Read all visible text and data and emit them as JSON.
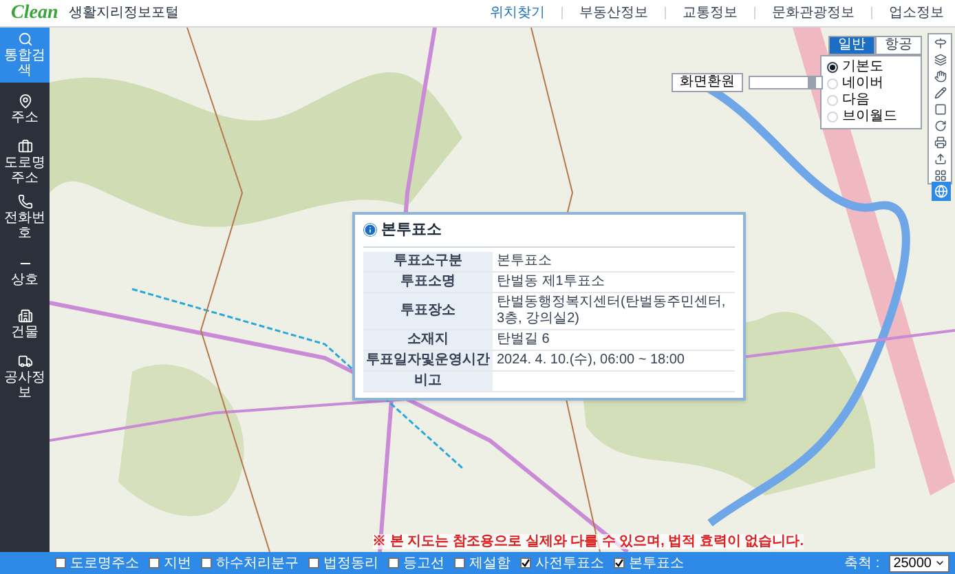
{
  "header": {
    "logo_text": "Clean",
    "title": "생활지리정보포털",
    "nav": [
      {
        "label": "위치찾기",
        "selected": true
      },
      {
        "label": "부동산정보",
        "selected": false
      },
      {
        "label": "교통정보",
        "selected": false
      },
      {
        "label": "문화관광정보",
        "selected": false
      },
      {
        "label": "업소정보",
        "selected": false
      }
    ]
  },
  "sidebar": {
    "items": [
      {
        "label": "통합검색",
        "selected": true
      },
      {
        "label": "주소",
        "selected": false
      },
      {
        "label": "도로명주소",
        "selected": false
      },
      {
        "label": "전화번호",
        "selected": false
      },
      {
        "label": "상호",
        "selected": false
      },
      {
        "label": "건물",
        "selected": false
      },
      {
        "label": "공사정보",
        "selected": false
      }
    ]
  },
  "map_controls": {
    "reset_button": "화면환원",
    "zoom_slider": {
      "level": 0.93
    },
    "map_type_tabs": [
      {
        "label": "일반",
        "selected": true
      },
      {
        "label": "항공",
        "selected": false
      }
    ],
    "base_maps": [
      {
        "label": "기본도",
        "selected": true
      },
      {
        "label": "네이버",
        "selected": false
      },
      {
        "label": "다음",
        "selected": false
      },
      {
        "label": "브이월드",
        "selected": false
      }
    ]
  },
  "popup": {
    "title": "본투표소",
    "rows": [
      {
        "label": "투표소구분",
        "value": "본투표소"
      },
      {
        "label": "투표소명",
        "value": "탄벌동 제1투표소"
      },
      {
        "label": "투표장소",
        "value": "탄벌동행정복지센터(탄벌동주민센터, 3층, 강의실2)"
      },
      {
        "label": "소재지",
        "value": "탄벌길 6"
      },
      {
        "label": "투표일자및운영시간",
        "value": "2024. 4. 10.(수), 06:00 ~ 18:00"
      },
      {
        "label": "비고"
      }
    ]
  },
  "notice": "※ 본 지도는 참조용으로 실제와 다를 수 있으며, 법적 효력이 없습니다.",
  "layers": [
    {
      "label": "도로명주소",
      "checked": false
    },
    {
      "label": "지번",
      "checked": false
    },
    {
      "label": "하수처리분구",
      "checked": false
    },
    {
      "label": "법정동리",
      "checked": false
    },
    {
      "label": "등고선",
      "checked": false
    },
    {
      "label": "제설함",
      "checked": false
    },
    {
      "label": "사전투표소",
      "checked": true
    },
    {
      "label": "본투표소",
      "checked": true
    }
  ],
  "scale": {
    "label": "축척 :",
    "value": "25000"
  }
}
